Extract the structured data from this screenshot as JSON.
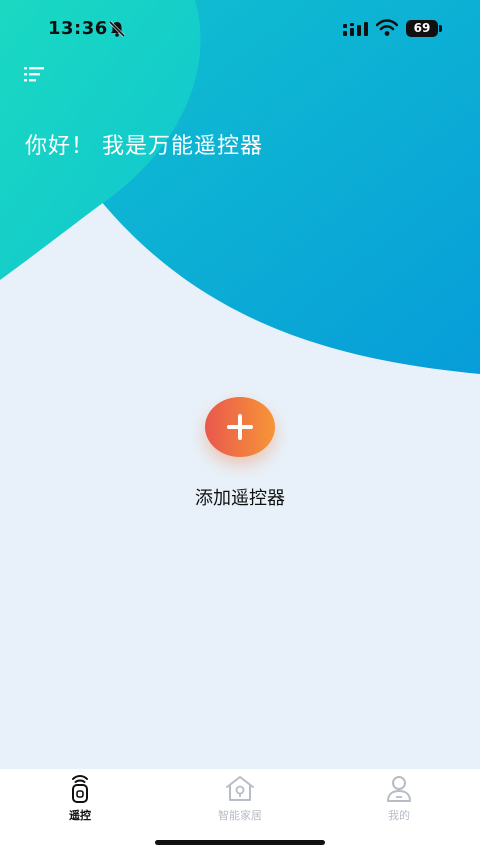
{
  "status_bar": {
    "time": "13:36",
    "battery": "69",
    "icons": [
      "bell-slash-icon",
      "signal-icon",
      "wifi-icon",
      "battery-icon"
    ]
  },
  "header": {
    "menu_icon": "menu-icon",
    "greeting": "你好！ 我是万能遥控器"
  },
  "main": {
    "add_icon": "plus-icon",
    "add_label": "添加遥控器",
    "accent_gradient": [
      "#e9584d",
      "#f79537"
    ]
  },
  "hero_colors": {
    "teal": "#19d3c5",
    "blue": "#079fd8"
  },
  "tabs": [
    {
      "label": "遥控",
      "icon": "remote-icon",
      "active": true
    },
    {
      "label": "智能家居",
      "icon": "smart-home-icon",
      "active": false
    },
    {
      "label": "我的",
      "icon": "profile-icon",
      "active": false
    }
  ]
}
